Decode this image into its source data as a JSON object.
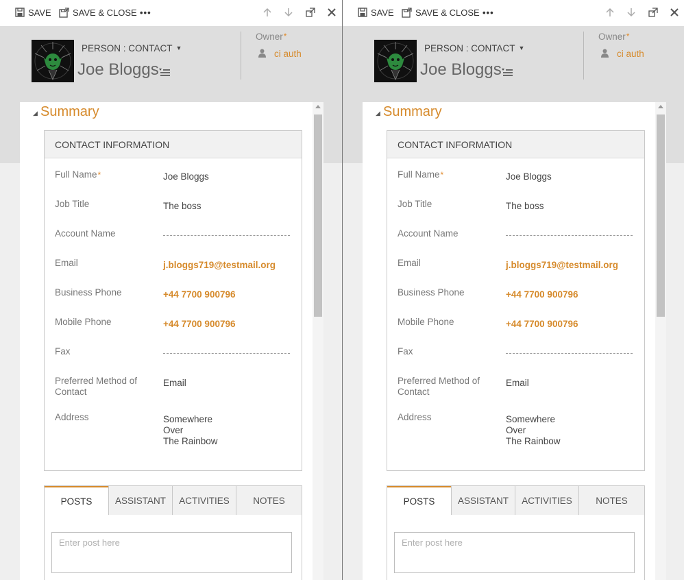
{
  "toolbar": {
    "save_label": "SAVE",
    "save_close_label": "SAVE & CLOSE",
    "more_label": "•••"
  },
  "header": {
    "form_selector": "PERSON : CONTACT",
    "record_name": "Joe Bloggs",
    "owner_label": "Owner",
    "owner_required": "*",
    "owner_value": "ci auth"
  },
  "summary": {
    "title": "Summary",
    "section_title": "CONTACT INFORMATION",
    "fields": {
      "full_name": {
        "label": "Full Name",
        "required": "*",
        "value": "Joe Bloggs"
      },
      "job_title": {
        "label": "Job Title",
        "value": "The boss"
      },
      "account_name": {
        "label": "Account Name",
        "value": ""
      },
      "email": {
        "label": "Email",
        "value": "j.bloggs719@testmail.org"
      },
      "business_phone": {
        "label": "Business Phone",
        "value": "+44 7700 900796"
      },
      "mobile_phone": {
        "label": "Mobile Phone",
        "value": "+44 7700 900796"
      },
      "fax": {
        "label": "Fax",
        "value": ""
      },
      "preferred_method": {
        "label": "Preferred Method of Contact",
        "value": "Email"
      },
      "address": {
        "label": "Address",
        "line1": "Somewhere",
        "line2": "Over",
        "line3": "The Rainbow"
      }
    }
  },
  "tabs": {
    "posts": "POSTS",
    "assistant": "ASSISTANT",
    "activities": "ACTIVITIES",
    "notes": "NOTES"
  },
  "posts": {
    "placeholder": "Enter post here"
  },
  "colors": {
    "accent": "#d68a2b",
    "header_bg": "#dedede",
    "page_bg": "#efefef"
  }
}
